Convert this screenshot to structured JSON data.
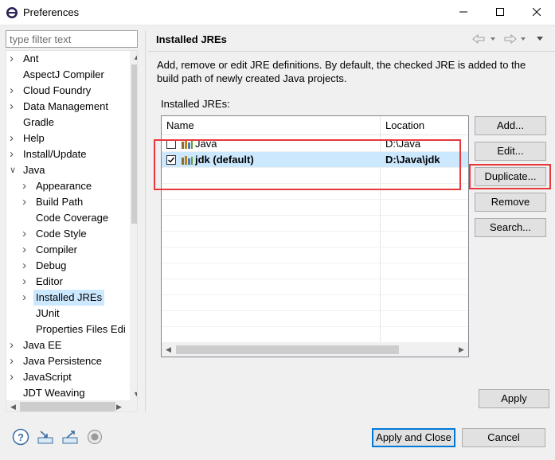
{
  "window": {
    "title": "Preferences",
    "minimize": "—",
    "maximize": "□",
    "close": "✕"
  },
  "filter": {
    "placeholder": "type filter text",
    "value": ""
  },
  "tree": {
    "items": [
      {
        "label": "Ant",
        "expanded": false,
        "level": 0
      },
      {
        "label": "AspectJ Compiler",
        "expanded": null,
        "level": 0
      },
      {
        "label": "Cloud Foundry",
        "expanded": false,
        "level": 0
      },
      {
        "label": "Data Management",
        "expanded": false,
        "level": 0
      },
      {
        "label": "Gradle",
        "expanded": null,
        "level": 0
      },
      {
        "label": "Help",
        "expanded": false,
        "level": 0
      },
      {
        "label": "Install/Update",
        "expanded": false,
        "level": 0
      },
      {
        "label": "Java",
        "expanded": true,
        "level": 0
      },
      {
        "label": "Appearance",
        "expanded": false,
        "level": 1
      },
      {
        "label": "Build Path",
        "expanded": false,
        "level": 1
      },
      {
        "label": "Code Coverage",
        "expanded": null,
        "level": 1
      },
      {
        "label": "Code Style",
        "expanded": false,
        "level": 1
      },
      {
        "label": "Compiler",
        "expanded": false,
        "level": 1
      },
      {
        "label": "Debug",
        "expanded": false,
        "level": 1
      },
      {
        "label": "Editor",
        "expanded": false,
        "level": 1
      },
      {
        "label": "Installed JREs",
        "expanded": false,
        "level": 1,
        "selected": true
      },
      {
        "label": "JUnit",
        "expanded": null,
        "level": 1
      },
      {
        "label": "Properties Files Edi",
        "expanded": null,
        "level": 1
      },
      {
        "label": "Java EE",
        "expanded": false,
        "level": 0
      },
      {
        "label": "Java Persistence",
        "expanded": false,
        "level": 0
      },
      {
        "label": "JavaScript",
        "expanded": false,
        "level": 0
      },
      {
        "label": "JDT Weaving",
        "expanded": null,
        "level": 0
      }
    ]
  },
  "page": {
    "title": "Installed JREs",
    "description": "Add, remove or edit JRE definitions. By default, the checked JRE is added to the build path of newly created Java projects.",
    "list_label": "Installed JREs:"
  },
  "table": {
    "headers": {
      "name": "Name",
      "location": "Location"
    },
    "rows": [
      {
        "name": "Java",
        "location": "D:\\Java",
        "checked": false,
        "bold": false,
        "selected": false
      },
      {
        "name": "jdk (default)",
        "location": "D:\\Java\\jdk",
        "checked": true,
        "bold": true,
        "selected": true
      }
    ]
  },
  "buttons": {
    "add": "Add...",
    "edit": "Edit...",
    "duplicate": "Duplicate...",
    "remove": "Remove",
    "search": "Search...",
    "apply": "Apply",
    "apply_close": "Apply and Close",
    "cancel": "Cancel"
  },
  "colors": {
    "highlight": "#e8383b",
    "selection": "#cce8ff",
    "focus": "#0078d7"
  }
}
